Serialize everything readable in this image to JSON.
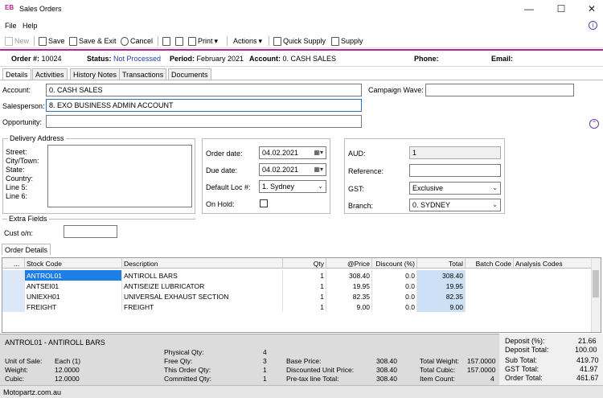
{
  "window": {
    "logo": "EB",
    "title": "Sales Orders",
    "minimize": "—",
    "maximize": "☐",
    "close": "✕"
  },
  "menu": {
    "file": "File",
    "help": "Help",
    "info": "i"
  },
  "toolbar": {
    "new": "New",
    "save": "Save",
    "save_exit": "Save & Exit",
    "cancel": "Cancel",
    "print": "Print",
    "actions": "Actions",
    "quick_supply": "Quick Supply",
    "supply": "Supply"
  },
  "header": {
    "order_label": "Order #:",
    "order_value": "10024",
    "status_label": "Status:",
    "status_value": "Not Processed",
    "period_label": "Period:",
    "period_value": "February 2021",
    "account_label": "Account:",
    "account_value": "0. CASH SALES",
    "phone_label": "Phone:",
    "email_label": "Email:"
  },
  "tabs": [
    "Details",
    "Activities",
    "History Notes",
    "Transactions",
    "Documents"
  ],
  "details": {
    "account_label": "Account:",
    "account_value": "0. CASH SALES",
    "salesperson_label": "Salesperson:",
    "salesperson_value": "8. EXO BUSINESS ADMIN ACCOUNT",
    "opportunity_label": "Opportunity:",
    "opportunity_value": "",
    "campaign_label": "Campaign Wave:",
    "campaign_value": ""
  },
  "delivery": {
    "title": "Delivery Address",
    "street": "Street:",
    "city": "City/Town:",
    "state": "State:",
    "country": "Country:",
    "line5": "Line 5:",
    "line6": "Line 6:"
  },
  "dates": {
    "order_date_label": "Order date:",
    "order_date": "04.02.2021",
    "due_date_label": "Due date:",
    "due_date": "04.02.2021",
    "default_loc_label": "Default Loc #:",
    "default_loc": "1. Sydney",
    "on_hold_label": "On Hold:"
  },
  "currency": {
    "aud_label": "AUD:",
    "aud_value": "1",
    "reference_label": "Reference:",
    "reference_value": "",
    "gst_label": "GST:",
    "gst_value": "Exclusive",
    "branch_label": "Branch:",
    "branch_value": "0. SYDNEY"
  },
  "extra": {
    "title": "Extra Fields",
    "cust_label": "Cust o/n:",
    "cust_value": ""
  },
  "order_details_tab": "Order Details",
  "grid": {
    "columns": [
      "...",
      "Stock Code",
      "Description",
      "Qty",
      "@Price",
      "Discount (%)",
      "Total",
      "Batch Code",
      "Analysis Codes"
    ],
    "rows": [
      {
        "code": "ANTROL01",
        "desc": "ANTIROLL BARS",
        "qty": "1",
        "price": "308.40",
        "disc": "0.0",
        "total": "308.40"
      },
      {
        "code": "ANTSEI01",
        "desc": "ANTISEIZE LUBRICATOR",
        "qty": "1",
        "price": "19.95",
        "disc": "0.0",
        "total": "19.95"
      },
      {
        "code": "UNIEXH01",
        "desc": "UNIVERSAL EXHAUST SECTION",
        "qty": "1",
        "price": "82.35",
        "disc": "0.0",
        "total": "82.35"
      },
      {
        "code": "FREIGHT",
        "desc": "FREIGHT",
        "qty": "1",
        "price": "9.00",
        "disc": "0.0",
        "total": "9.00"
      }
    ]
  },
  "summary": {
    "item": "ANTROL01 - ANTIROLL BARS",
    "unit_label": "Unit of Sale:",
    "unit_value": "Each (1)",
    "weight_label": "Weight:",
    "weight_value": "12.0000",
    "cubic_label": "Cubic:",
    "cubic_value": "12.0000",
    "physical_label": "Physical Qty:",
    "physical_value": "4",
    "free_label": "Free Qty:",
    "free_value": "3",
    "this_order_label": "This Order Qty:",
    "this_order_value": "1",
    "committed_label": "Committed Qty:",
    "committed_value": "1",
    "base_label": "Base Price:",
    "base_value": "308.40",
    "disc_unit_label": "Discounted Unit Price:",
    "disc_unit_value": "308.40",
    "pretax_label": "Pre-tax line Total:",
    "pretax_value": "308.40",
    "tweight_label": "Total Weight:",
    "tweight_value": "157.0000",
    "tcubic_label": "Total Cubic:",
    "tcubic_value": "157.0000",
    "itemcount_label": "Item Count:",
    "itemcount_value": "4",
    "deposit_pct_label": "Deposit (%):",
    "deposit_pct_value": "21.66",
    "deposit_total_label": "Deposit Total:",
    "deposit_total_value": "100.00",
    "subtotal_label": "Sub Total:",
    "subtotal_value": "419.70",
    "gst_total_label": "GST Total:",
    "gst_total_value": "41.97",
    "order_total_label": "Order Total:",
    "order_total_value": "461.67"
  },
  "status": {
    "url": "Motopartz.com.au"
  }
}
